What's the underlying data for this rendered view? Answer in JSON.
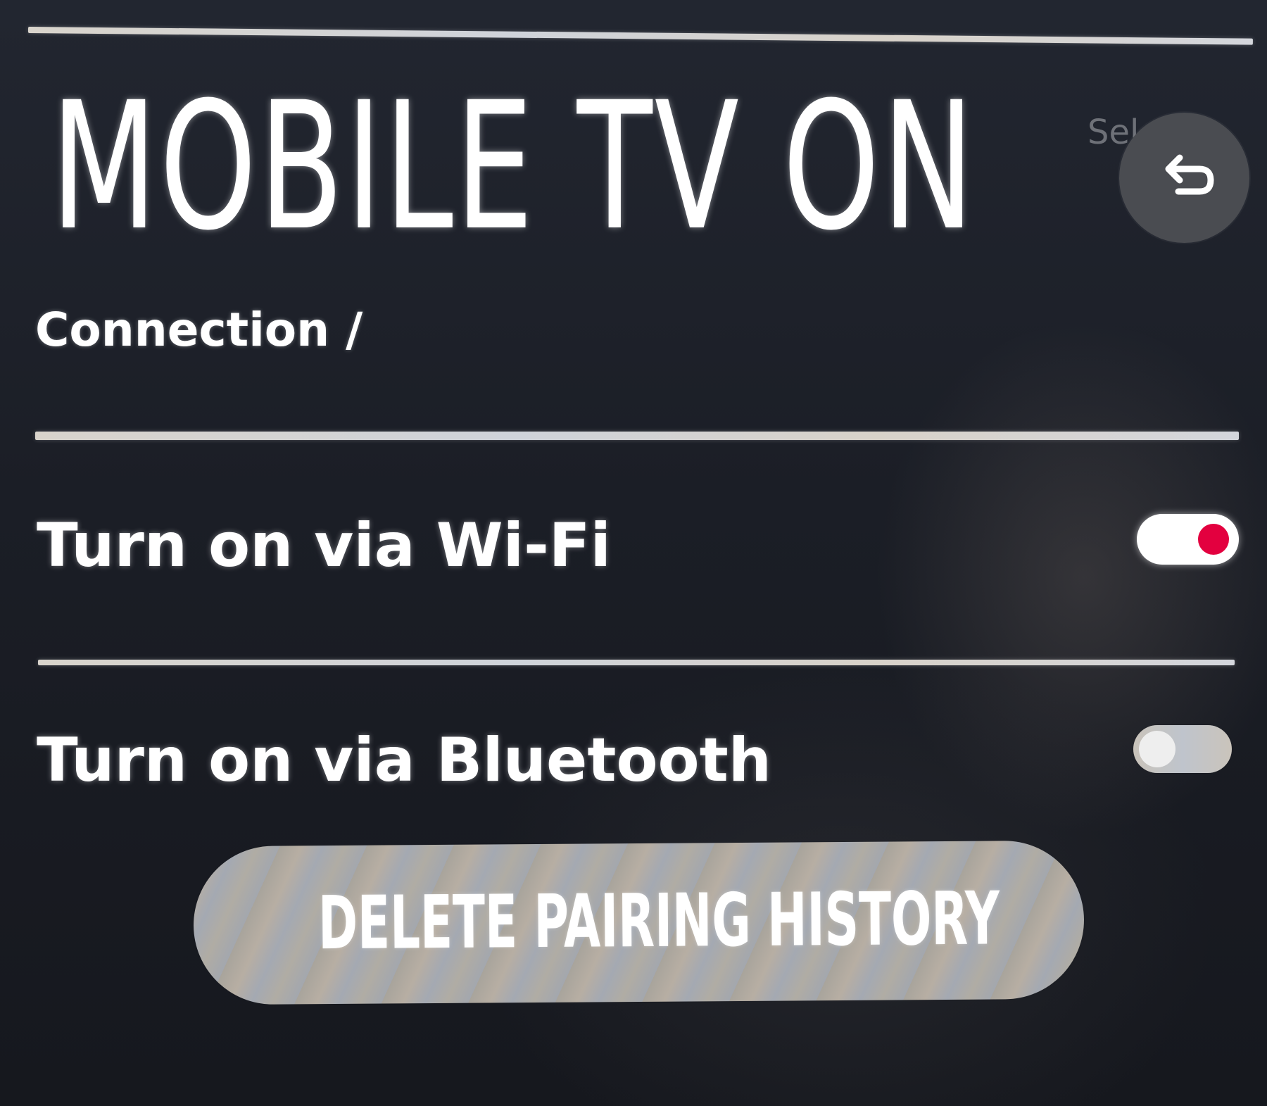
{
  "header": {
    "title": "MOBILE TV ON",
    "hint_text": "Sel",
    "back_button": {
      "icon": "back-arrow-icon"
    }
  },
  "breadcrumb": "Connection /",
  "settings": [
    {
      "label": "Turn on via Wi-Fi",
      "enabled": true
    },
    {
      "label": "Turn on via Bluetooth",
      "enabled": false
    }
  ],
  "actions": {
    "delete_pairing_history": "DELETE PAIRING HISTORY"
  },
  "colors": {
    "background": "#1b1e26",
    "text": "#ffffff",
    "toggle_on_knob": "#e3003f",
    "back_button": "#4a4c51"
  }
}
